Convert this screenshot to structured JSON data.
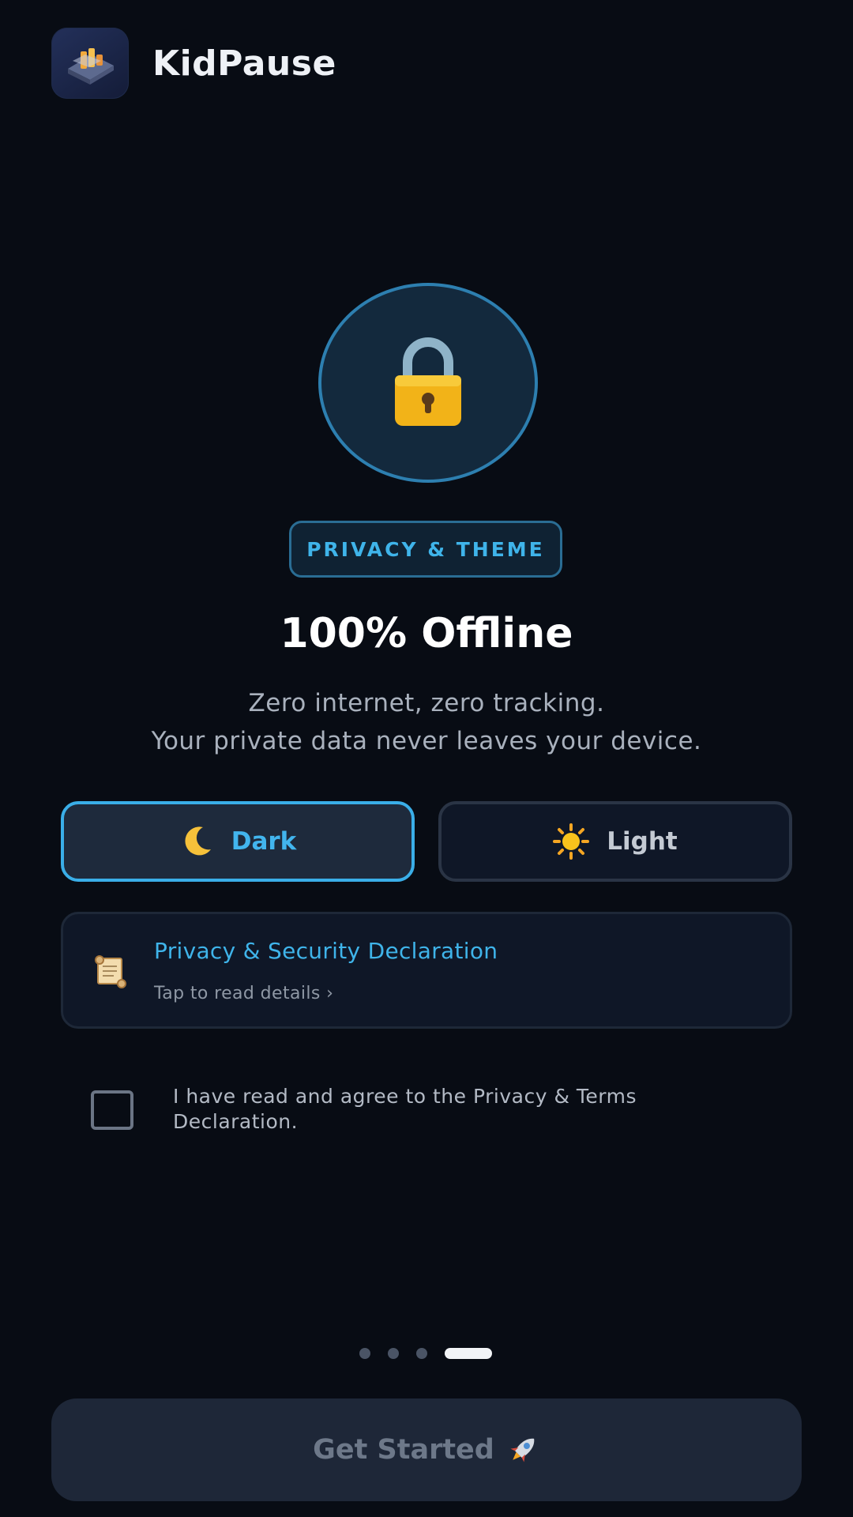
{
  "header": {
    "app_name": "KidPause",
    "logo_icon": "app-logo-icon"
  },
  "hero": {
    "icon": "lock-icon",
    "badge": "PRIVACY & THEME",
    "title": "100% Offline",
    "subtitle_line1": "Zero internet, zero tracking.",
    "subtitle_line2": "Your private data never leaves your device."
  },
  "theme": {
    "selected": "Dark",
    "options": [
      {
        "label": "Dark",
        "icon": "moon-icon"
      },
      {
        "label": "Light",
        "icon": "sun-icon"
      }
    ]
  },
  "privacy_card": {
    "icon": "scroll-icon",
    "title": "Privacy & Security Declaration",
    "subtitle": "Tap to read details ›"
  },
  "agreement": {
    "checked": false,
    "text": "I have read and agree to the Privacy & Terms Declaration."
  },
  "pager": {
    "total": 4,
    "current": 4
  },
  "cta": {
    "label": "Get Started",
    "icon": "rocket-icon",
    "enabled": false
  },
  "colors": {
    "background": "#080c14",
    "accent": "#3fb4ea",
    "card": "#0f1727",
    "cta_disabled": "#1e2738"
  }
}
